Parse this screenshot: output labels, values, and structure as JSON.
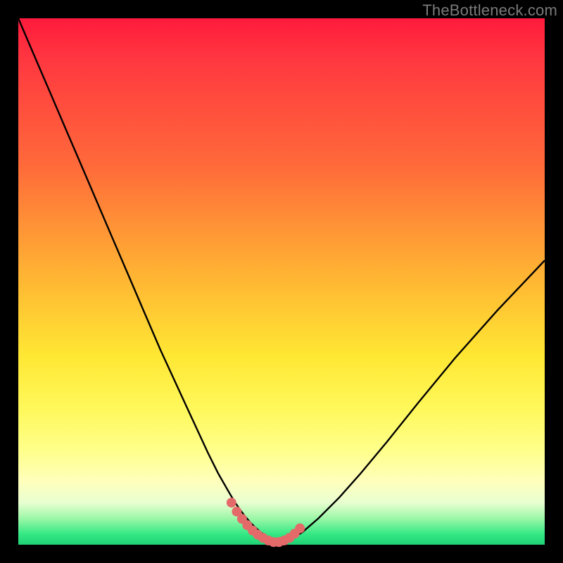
{
  "watermark": {
    "text": "TheBottleneck.com"
  },
  "colors": {
    "background": "#000000",
    "curve_stroke": "#000000",
    "marker_fill": "#e46a6a",
    "gradient_top": "#ff1a3c",
    "gradient_bottom": "#1fd276"
  },
  "chart_data": {
    "type": "line",
    "title": "",
    "xlabel": "",
    "ylabel": "",
    "xlim": [
      0,
      100
    ],
    "ylim": [
      0,
      100
    ],
    "grid": false,
    "legend": false,
    "annotations": [],
    "series": [
      {
        "name": "bottleneck-curve",
        "x": [
          0,
          3,
          6,
          9,
          12,
          15,
          18,
          21,
          24,
          27,
          30,
          33,
          36,
          38,
          40,
          41,
          42,
          43,
          44,
          45,
          46,
          47,
          48,
          49,
          50,
          51,
          52,
          54,
          57,
          61,
          65,
          70,
          76,
          83,
          91,
          100
        ],
        "y": [
          100,
          93,
          86,
          79,
          72,
          65,
          58,
          51,
          44,
          37,
          30.5,
          24,
          17.5,
          13.5,
          10,
          8.3,
          6.8,
          5.5,
          4.3,
          3.3,
          2.4,
          1.7,
          1.1,
          0.6,
          0.3,
          0.6,
          1.1,
          2.4,
          5.0,
          9.0,
          13.5,
          19.5,
          27.0,
          35.5,
          44.5,
          54.0
        ]
      },
      {
        "name": "bottom-markers",
        "x": [
          40.5,
          41.5,
          42.5,
          43.5,
          44.5,
          45.5,
          46.5,
          47.5,
          48.5,
          49.5,
          50.5,
          51.5,
          52.5,
          53.5
        ],
        "y": [
          8.0,
          6.3,
          4.9,
          3.7,
          2.7,
          1.9,
          1.3,
          0.8,
          0.5,
          0.5,
          0.8,
          1.3,
          2.1,
          3.1
        ]
      }
    ]
  }
}
